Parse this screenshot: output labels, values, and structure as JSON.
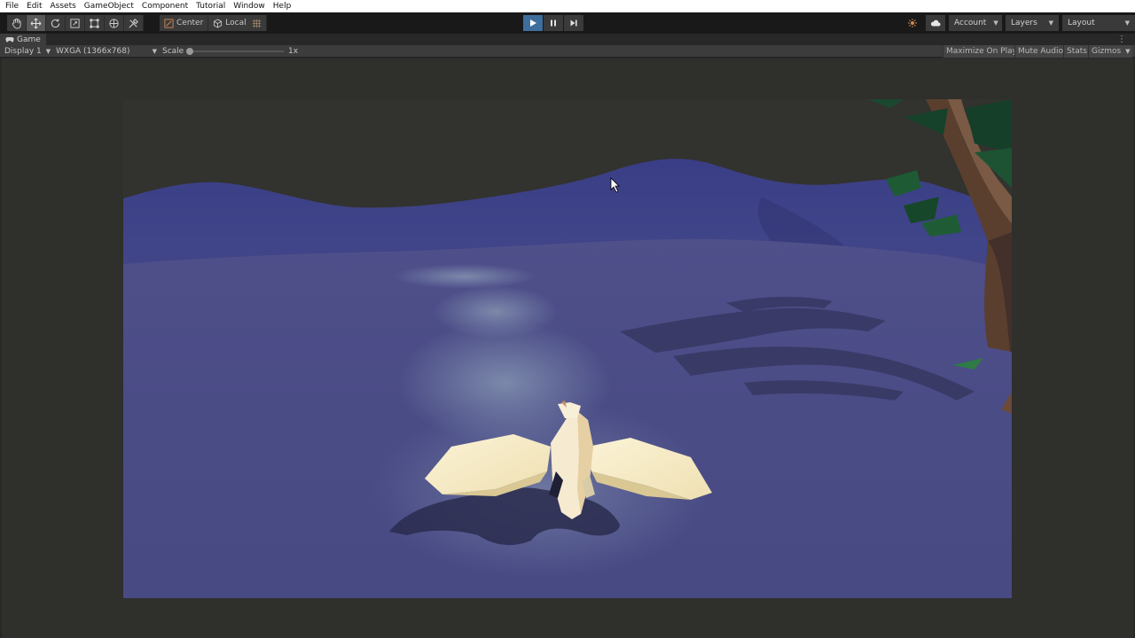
{
  "menu": [
    "File",
    "Edit",
    "Assets",
    "GameObject",
    "Component",
    "Tutorial",
    "Window",
    "Help"
  ],
  "toolbar": {
    "tools": [
      "hand-icon",
      "move-icon",
      "rotate-icon",
      "scale-icon",
      "rect-icon",
      "transform-icon",
      "custom-tool-icon"
    ],
    "active_tool": "move-icon",
    "pivot_mode": "Center",
    "pivot_rotation": "Local",
    "playing": true,
    "account_label": "Account",
    "layers_label": "Layers",
    "layout_label": "Layout"
  },
  "tab": {
    "label": "Game"
  },
  "gamebar": {
    "display": "Display 1",
    "resolution": "WXGA (1366x768)",
    "scale_label": "Scale",
    "scale_value": "1x",
    "maximize_label": "Maximize On Play",
    "mute_label": "Mute Audio",
    "stats_label": "Stats",
    "gizmos_label": "Gizmos"
  },
  "colors": {
    "play_accent": "#3d6e9c",
    "terrain": "#4b4b86",
    "sky": "#32322f",
    "dragon": "#f3e9c8"
  }
}
